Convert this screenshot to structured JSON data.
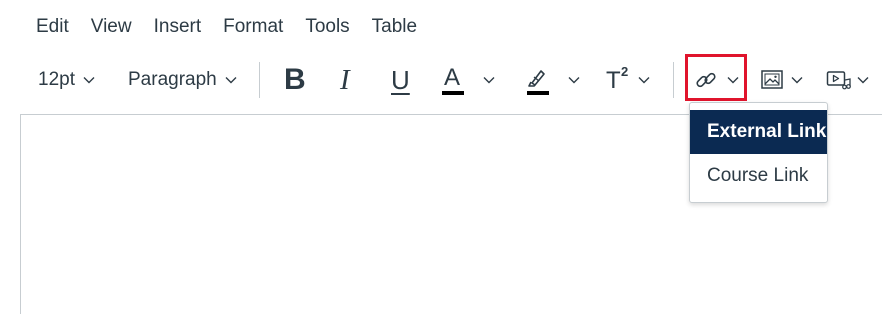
{
  "menubar": {
    "items": [
      {
        "label": "Edit"
      },
      {
        "label": "View"
      },
      {
        "label": "Insert"
      },
      {
        "label": "Format"
      },
      {
        "label": "Tools"
      },
      {
        "label": "Table"
      }
    ]
  },
  "toolbar": {
    "font_size": "12pt",
    "block_format": "Paragraph",
    "bold_label": "B",
    "italic_label": "I",
    "underline_label": "U",
    "text_color_label": "A",
    "superscript_label": "T",
    "superscript_mark": "2",
    "icons": {
      "link": "link-icon",
      "image": "image-icon",
      "media": "media-icon",
      "highlight": "highlighter-icon",
      "chevron": "chevron-down-icon"
    },
    "colors": {
      "text_color_bar": "#000000",
      "highlight_bar": "#000000",
      "focus_outline": "#e0142c"
    }
  },
  "link_menu": {
    "items": [
      {
        "label": "External Link",
        "active": true
      },
      {
        "label": "Course Link",
        "active": false
      }
    ],
    "active_bg": "#0b2a52"
  }
}
